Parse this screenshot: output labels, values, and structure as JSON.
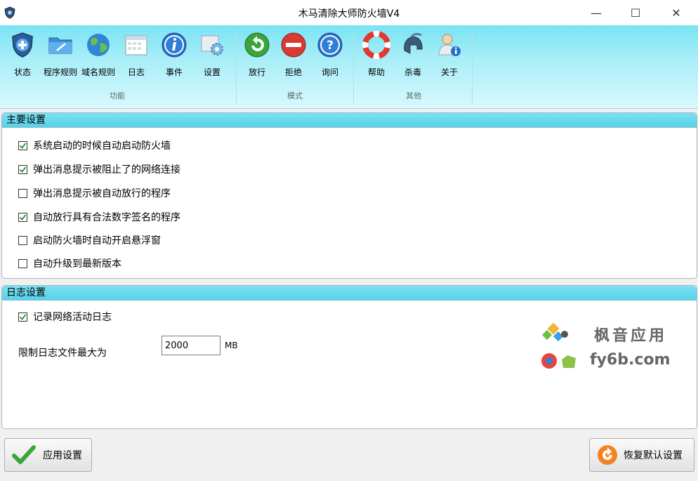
{
  "window": {
    "title": "木马清除大师防火墙V4",
    "controls": {
      "minimize": "—",
      "maximize": "☐",
      "close": "✕"
    }
  },
  "ribbon": {
    "groups": [
      {
        "label": "功能",
        "tools": [
          {
            "label": "状态",
            "icon": "shield-plus-icon"
          },
          {
            "label": "程序规则",
            "icon": "folder-icon"
          },
          {
            "label": "域名规则",
            "icon": "globe-icon"
          },
          {
            "label": "日志",
            "icon": "calendar-icon"
          },
          {
            "label": "事件",
            "icon": "info-icon"
          },
          {
            "label": "设置",
            "icon": "settings-icon"
          }
        ]
      },
      {
        "label": "模式",
        "tools": [
          {
            "label": "放行",
            "icon": "allow-icon"
          },
          {
            "label": "拒绝",
            "icon": "deny-icon"
          },
          {
            "label": "询问",
            "icon": "question-icon"
          }
        ]
      },
      {
        "label": "其他",
        "tools": [
          {
            "label": "帮助",
            "icon": "lifebuoy-icon"
          },
          {
            "label": "杀毒",
            "icon": "helmet-icon"
          },
          {
            "label": "关于",
            "icon": "user-info-icon"
          }
        ]
      }
    ]
  },
  "main_settings": {
    "header": "主要设置",
    "options": [
      {
        "label": "系统启动的时候自动启动防火墙",
        "checked": true
      },
      {
        "label": "弹出消息提示被阻止了的网络连接",
        "checked": true
      },
      {
        "label": "弹出消息提示被自动放行的程序",
        "checked": false
      },
      {
        "label": "自动放行具有合法数字签名的程序",
        "checked": true
      },
      {
        "label": "启动防火墙时自动开启悬浮窗",
        "checked": false
      },
      {
        "label": "自动升级到最新版本",
        "checked": false
      }
    ]
  },
  "log_settings": {
    "header": "日志设置",
    "record_label": "记录网络活动日志",
    "record_checked": true,
    "limit_label": "限制日志文件最大为",
    "limit_value": "2000",
    "limit_unit": "MB"
  },
  "watermark": {
    "line1": "枫音应用",
    "line2": "fy6b.com"
  },
  "footer": {
    "apply_label": "应用设置",
    "restore_label": "恢复默认设置"
  },
  "colors": {
    "ribbon": "#8de8f6",
    "panel_header": "#5fd4ec",
    "check": "#1a8f2e",
    "restore": "#f58220"
  }
}
